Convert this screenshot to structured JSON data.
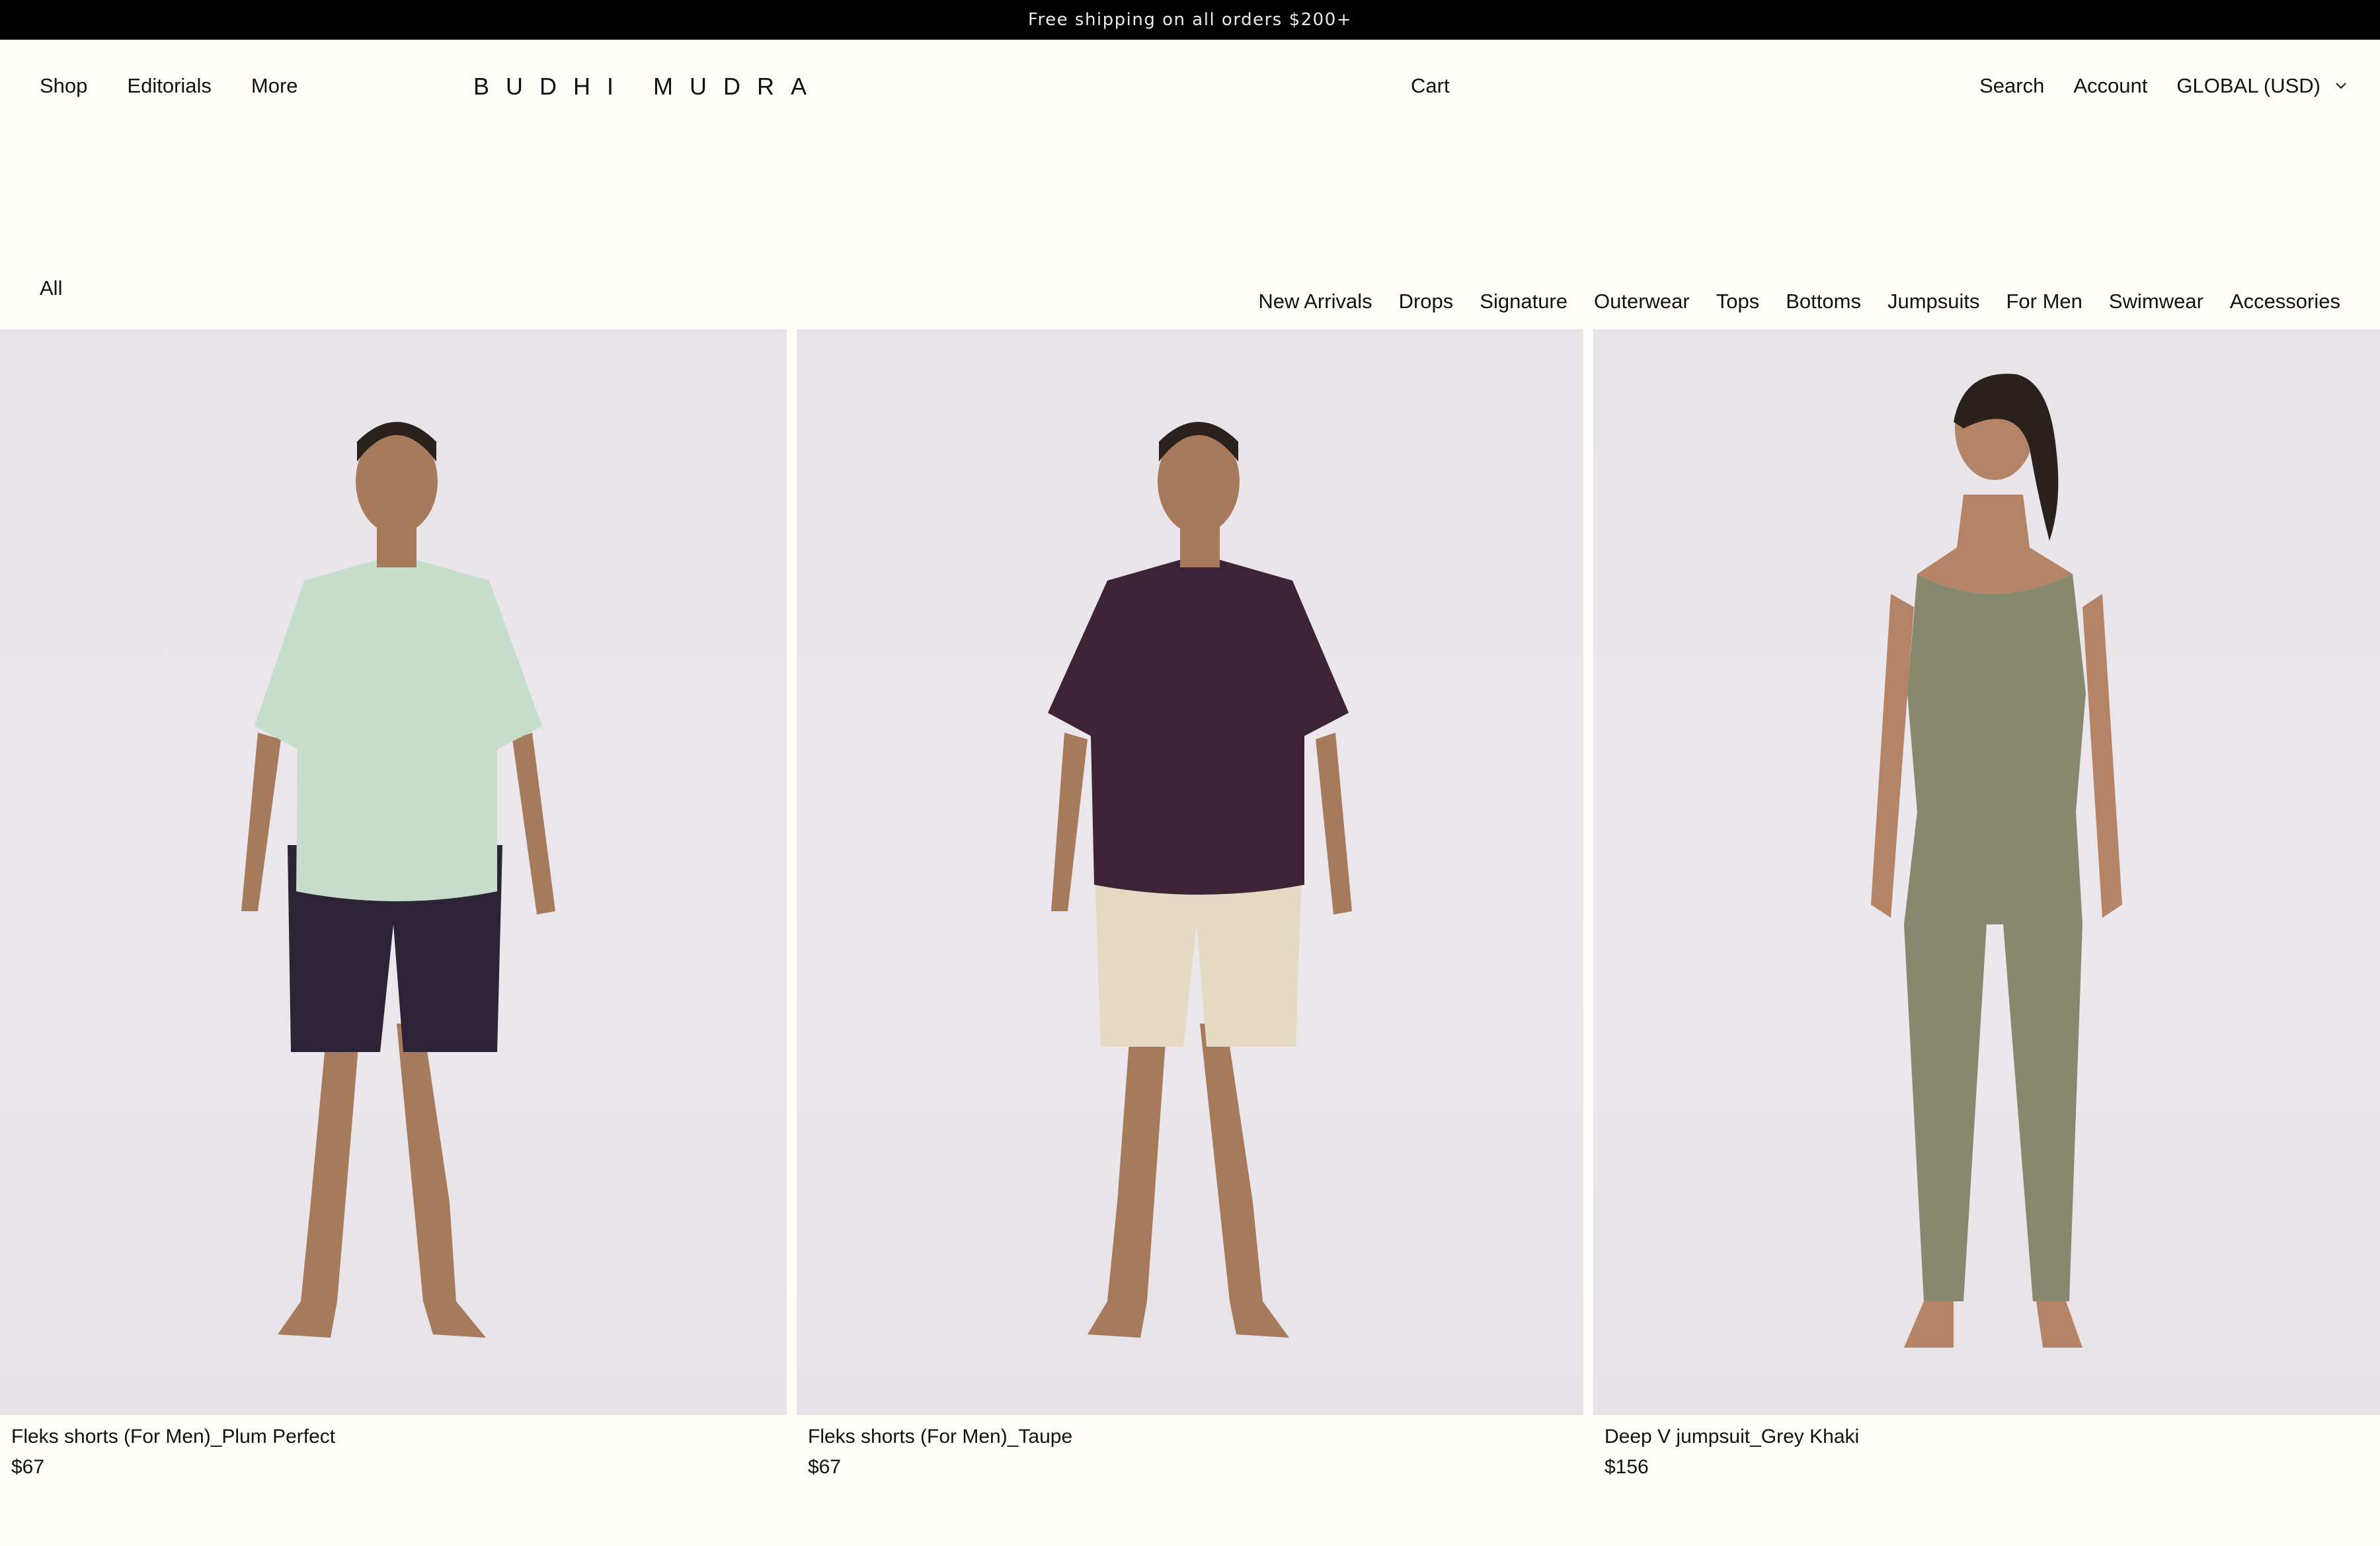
{
  "announcement": "Free shipping on all orders $200+",
  "header": {
    "nav_left": [
      "Shop",
      "Editorials",
      "More"
    ],
    "logo": "BUDHI MUDRA",
    "cart": "Cart",
    "search": "Search",
    "account": "Account",
    "currency": "GLOBAL (USD)"
  },
  "collection": {
    "all_label": "All",
    "filters": [
      "New Arrivals",
      "Drops",
      "Signature",
      "Outerwear",
      "Tops",
      "Bottoms",
      "Jumpsuits",
      "For Men",
      "Swimwear",
      "Accessories"
    ]
  },
  "products": [
    {
      "name": "Fleks shorts (For Men)_Plum Perfect",
      "price": "$67",
      "top_color": "#c6ddcc",
      "bottom_color": "#2c2436"
    },
    {
      "name": "Fleks shorts (For Men)_Taupe",
      "price": "$67",
      "top_color": "#3d2335",
      "bottom_color": "#e4dac4"
    },
    {
      "name": "Deep V jumpsuit_Grey Khaki",
      "price": "$156",
      "top_color": "#87896e",
      "bottom_color": "#87896e"
    }
  ],
  "icons": {
    "currency_toggle": "chevron-down-icon"
  }
}
